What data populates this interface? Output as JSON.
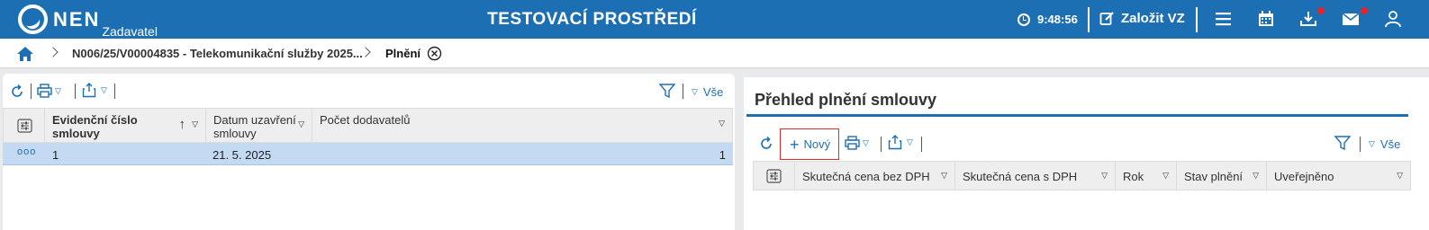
{
  "header": {
    "logo_text": "NEN",
    "logo_sub": "Zadavatel",
    "env_title": "TESTOVACÍ PROSTŘEDÍ",
    "time": "9:48:56",
    "create_label": "Založit VZ",
    "colors": {
      "bar": "#1d6fb4",
      "notification": "#e3262c"
    }
  },
  "breadcrumb": {
    "items": [
      "N006/25/V00004835 - Telekomunikační služby 2025...",
      "Plnění"
    ]
  },
  "left_panel": {
    "filter_all": "Vše",
    "columns": [
      {
        "label": "Evidenční číslo smlouvy"
      },
      {
        "label": "Datum uzavření smlouvy"
      },
      {
        "label": "Počet dodavatelů"
      }
    ],
    "rows": [
      {
        "menu": "ooo",
        "number": "1",
        "date": "21. 5. 2025",
        "suppliers": "1"
      }
    ]
  },
  "right_panel": {
    "title": "Přehled plnění smlouvy",
    "new_label": "Nový",
    "filter_all": "Vše",
    "columns": [
      {
        "label": "Skutečná cena bez DPH"
      },
      {
        "label": "Skutečná cena s DPH"
      },
      {
        "label": "Rok"
      },
      {
        "label": "Stav plnění"
      },
      {
        "label": "Uveřejněno"
      }
    ]
  }
}
